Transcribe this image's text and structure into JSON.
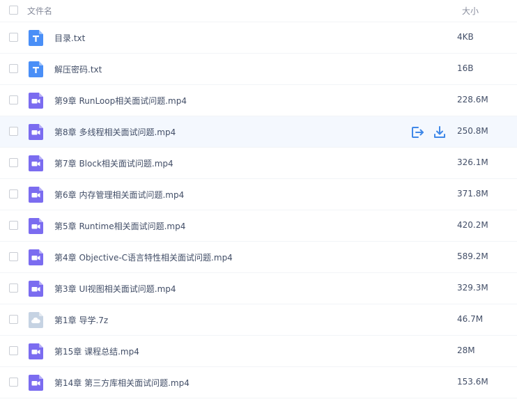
{
  "header": {
    "name_label": "文件名",
    "size_label": "大小"
  },
  "colors": {
    "txt_icon": "#4a8ff7",
    "video_icon": "#7b6cf0",
    "archive_icon": "#c6d3e3",
    "action_icon": "#3f88e8",
    "hover_row": "#f4f8fe"
  },
  "files": [
    {
      "name": "目录.txt",
      "size": "4KB",
      "icon": "txt-file-icon"
    },
    {
      "name": "解压密码.txt",
      "size": "16B",
      "icon": "txt-file-icon"
    },
    {
      "name": "第9章 RunLoop相关面试问题.mp4",
      "size": "228.6M",
      "icon": "video-file-icon"
    },
    {
      "name": "第8章 多线程相关面试问题.mp4",
      "size": "250.8M",
      "icon": "video-file-icon",
      "hovered": true
    },
    {
      "name": "第7章 Block相关面试问题.mp4",
      "size": "326.1M",
      "icon": "video-file-icon"
    },
    {
      "name": "第6章 内存管理相关面试问题.mp4",
      "size": "371.8M",
      "icon": "video-file-icon"
    },
    {
      "name": "第5章 Runtime相关面试问题.mp4",
      "size": "420.2M",
      "icon": "video-file-icon"
    },
    {
      "name": "第4章 Objective-C语言特性相关面试问题.mp4",
      "size": "589.2M",
      "icon": "video-file-icon"
    },
    {
      "name": "第3章 UI视图相关面试问题.mp4",
      "size": "329.3M",
      "icon": "video-file-icon"
    },
    {
      "name": "第1章 导学.7z",
      "size": "46.7M",
      "icon": "archive-file-icon"
    },
    {
      "name": "第15章 课程总结.mp4",
      "size": "28M",
      "icon": "video-file-icon"
    },
    {
      "name": "第14章 第三方库相关面试问题.mp4",
      "size": "153.6M",
      "icon": "video-file-icon"
    }
  ]
}
